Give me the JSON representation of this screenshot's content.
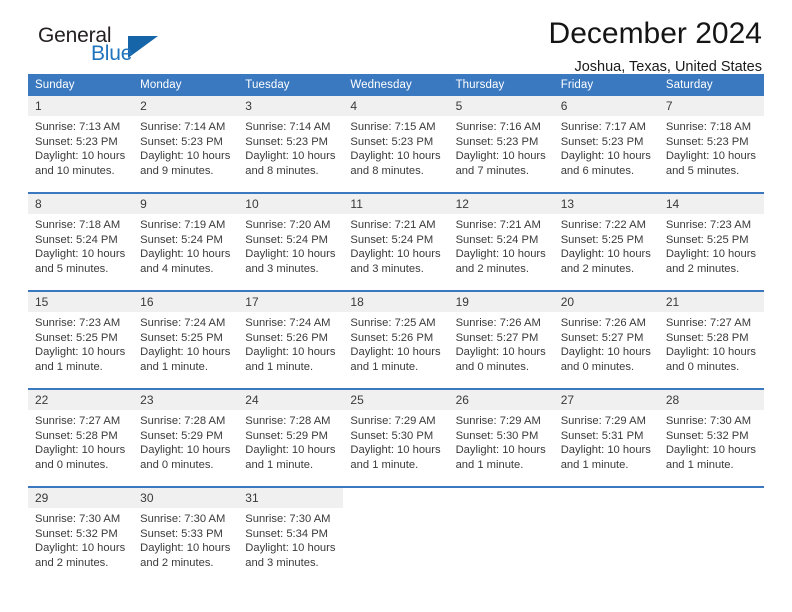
{
  "brand": {
    "word_one": "General",
    "word_two": "Blue",
    "triangle_icon": "brand-triangle-icon"
  },
  "header": {
    "title": "December 2024",
    "location": "Joshua, Texas, United States"
  },
  "colors": {
    "header_blue": "#3a79c0",
    "daynum_band": "#f0f0f0",
    "brand_blue": "#1f74bd",
    "text": "#3a3a3a"
  },
  "weekdays": [
    "Sunday",
    "Monday",
    "Tuesday",
    "Wednesday",
    "Thursday",
    "Friday",
    "Saturday"
  ],
  "weeks": [
    [
      {
        "day": "1",
        "sunrise": "Sunrise: 7:13 AM",
        "sunset": "Sunset: 5:23 PM",
        "daylight_1": "Daylight: 10 hours",
        "daylight_2": "and 10 minutes."
      },
      {
        "day": "2",
        "sunrise": "Sunrise: 7:14 AM",
        "sunset": "Sunset: 5:23 PM",
        "daylight_1": "Daylight: 10 hours",
        "daylight_2": "and 9 minutes."
      },
      {
        "day": "3",
        "sunrise": "Sunrise: 7:14 AM",
        "sunset": "Sunset: 5:23 PM",
        "daylight_1": "Daylight: 10 hours",
        "daylight_2": "and 8 minutes."
      },
      {
        "day": "4",
        "sunrise": "Sunrise: 7:15 AM",
        "sunset": "Sunset: 5:23 PM",
        "daylight_1": "Daylight: 10 hours",
        "daylight_2": "and 8 minutes."
      },
      {
        "day": "5",
        "sunrise": "Sunrise: 7:16 AM",
        "sunset": "Sunset: 5:23 PM",
        "daylight_1": "Daylight: 10 hours",
        "daylight_2": "and 7 minutes."
      },
      {
        "day": "6",
        "sunrise": "Sunrise: 7:17 AM",
        "sunset": "Sunset: 5:23 PM",
        "daylight_1": "Daylight: 10 hours",
        "daylight_2": "and 6 minutes."
      },
      {
        "day": "7",
        "sunrise": "Sunrise: 7:18 AM",
        "sunset": "Sunset: 5:23 PM",
        "daylight_1": "Daylight: 10 hours",
        "daylight_2": "and 5 minutes."
      }
    ],
    [
      {
        "day": "8",
        "sunrise": "Sunrise: 7:18 AM",
        "sunset": "Sunset: 5:24 PM",
        "daylight_1": "Daylight: 10 hours",
        "daylight_2": "and 5 minutes."
      },
      {
        "day": "9",
        "sunrise": "Sunrise: 7:19 AM",
        "sunset": "Sunset: 5:24 PM",
        "daylight_1": "Daylight: 10 hours",
        "daylight_2": "and 4 minutes."
      },
      {
        "day": "10",
        "sunrise": "Sunrise: 7:20 AM",
        "sunset": "Sunset: 5:24 PM",
        "daylight_1": "Daylight: 10 hours",
        "daylight_2": "and 3 minutes."
      },
      {
        "day": "11",
        "sunrise": "Sunrise: 7:21 AM",
        "sunset": "Sunset: 5:24 PM",
        "daylight_1": "Daylight: 10 hours",
        "daylight_2": "and 3 minutes."
      },
      {
        "day": "12",
        "sunrise": "Sunrise: 7:21 AM",
        "sunset": "Sunset: 5:24 PM",
        "daylight_1": "Daylight: 10 hours",
        "daylight_2": "and 2 minutes."
      },
      {
        "day": "13",
        "sunrise": "Sunrise: 7:22 AM",
        "sunset": "Sunset: 5:25 PM",
        "daylight_1": "Daylight: 10 hours",
        "daylight_2": "and 2 minutes."
      },
      {
        "day": "14",
        "sunrise": "Sunrise: 7:23 AM",
        "sunset": "Sunset: 5:25 PM",
        "daylight_1": "Daylight: 10 hours",
        "daylight_2": "and 2 minutes."
      }
    ],
    [
      {
        "day": "15",
        "sunrise": "Sunrise: 7:23 AM",
        "sunset": "Sunset: 5:25 PM",
        "daylight_1": "Daylight: 10 hours",
        "daylight_2": "and 1 minute."
      },
      {
        "day": "16",
        "sunrise": "Sunrise: 7:24 AM",
        "sunset": "Sunset: 5:25 PM",
        "daylight_1": "Daylight: 10 hours",
        "daylight_2": "and 1 minute."
      },
      {
        "day": "17",
        "sunrise": "Sunrise: 7:24 AM",
        "sunset": "Sunset: 5:26 PM",
        "daylight_1": "Daylight: 10 hours",
        "daylight_2": "and 1 minute."
      },
      {
        "day": "18",
        "sunrise": "Sunrise: 7:25 AM",
        "sunset": "Sunset: 5:26 PM",
        "daylight_1": "Daylight: 10 hours",
        "daylight_2": "and 1 minute."
      },
      {
        "day": "19",
        "sunrise": "Sunrise: 7:26 AM",
        "sunset": "Sunset: 5:27 PM",
        "daylight_1": "Daylight: 10 hours",
        "daylight_2": "and 0 minutes."
      },
      {
        "day": "20",
        "sunrise": "Sunrise: 7:26 AM",
        "sunset": "Sunset: 5:27 PM",
        "daylight_1": "Daylight: 10 hours",
        "daylight_2": "and 0 minutes."
      },
      {
        "day": "21",
        "sunrise": "Sunrise: 7:27 AM",
        "sunset": "Sunset: 5:28 PM",
        "daylight_1": "Daylight: 10 hours",
        "daylight_2": "and 0 minutes."
      }
    ],
    [
      {
        "day": "22",
        "sunrise": "Sunrise: 7:27 AM",
        "sunset": "Sunset: 5:28 PM",
        "daylight_1": "Daylight: 10 hours",
        "daylight_2": "and 0 minutes."
      },
      {
        "day": "23",
        "sunrise": "Sunrise: 7:28 AM",
        "sunset": "Sunset: 5:29 PM",
        "daylight_1": "Daylight: 10 hours",
        "daylight_2": "and 0 minutes."
      },
      {
        "day": "24",
        "sunrise": "Sunrise: 7:28 AM",
        "sunset": "Sunset: 5:29 PM",
        "daylight_1": "Daylight: 10 hours",
        "daylight_2": "and 1 minute."
      },
      {
        "day": "25",
        "sunrise": "Sunrise: 7:29 AM",
        "sunset": "Sunset: 5:30 PM",
        "daylight_1": "Daylight: 10 hours",
        "daylight_2": "and 1 minute."
      },
      {
        "day": "26",
        "sunrise": "Sunrise: 7:29 AM",
        "sunset": "Sunset: 5:30 PM",
        "daylight_1": "Daylight: 10 hours",
        "daylight_2": "and 1 minute."
      },
      {
        "day": "27",
        "sunrise": "Sunrise: 7:29 AM",
        "sunset": "Sunset: 5:31 PM",
        "daylight_1": "Daylight: 10 hours",
        "daylight_2": "and 1 minute."
      },
      {
        "day": "28",
        "sunrise": "Sunrise: 7:30 AM",
        "sunset": "Sunset: 5:32 PM",
        "daylight_1": "Daylight: 10 hours",
        "daylight_2": "and 1 minute."
      }
    ],
    [
      {
        "day": "29",
        "sunrise": "Sunrise: 7:30 AM",
        "sunset": "Sunset: 5:32 PM",
        "daylight_1": "Daylight: 10 hours",
        "daylight_2": "and 2 minutes."
      },
      {
        "day": "30",
        "sunrise": "Sunrise: 7:30 AM",
        "sunset": "Sunset: 5:33 PM",
        "daylight_1": "Daylight: 10 hours",
        "daylight_2": "and 2 minutes."
      },
      {
        "day": "31",
        "sunrise": "Sunrise: 7:30 AM",
        "sunset": "Sunset: 5:34 PM",
        "daylight_1": "Daylight: 10 hours",
        "daylight_2": "and 3 minutes."
      },
      {
        "day": "",
        "sunrise": "",
        "sunset": "",
        "daylight_1": "",
        "daylight_2": ""
      },
      {
        "day": "",
        "sunrise": "",
        "sunset": "",
        "daylight_1": "",
        "daylight_2": ""
      },
      {
        "day": "",
        "sunrise": "",
        "sunset": "",
        "daylight_1": "",
        "daylight_2": ""
      },
      {
        "day": "",
        "sunrise": "",
        "sunset": "",
        "daylight_1": "",
        "daylight_2": ""
      }
    ]
  ]
}
